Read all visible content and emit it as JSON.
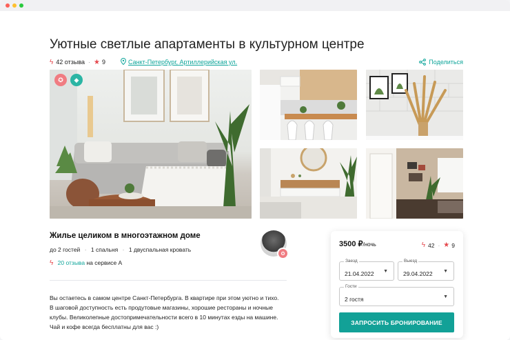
{
  "listing": {
    "title": "Уютные светлые апартаменты в культурном центре",
    "reviews_count": "42 отзыва",
    "rating": "9",
    "address": "Санкт-Петербург, Артиллерийская ул.",
    "share_label": "Поделиться"
  },
  "details": {
    "heading": "Жилье целиком в многоэтажном доме",
    "guests": "до 2 гостей",
    "bedrooms": "1 спальня",
    "beds": "1 двуспальная кровать",
    "service_reviews_link": "20 отзыва",
    "service_reviews_suffix": "на сервисе А",
    "description": "Вы остаетесь в самом центре Санкт-Петербурга. В квартире при этом уютно и тихо. В шаговой доступность есть продутовые магазины, хорошие рестораны и ночные клубы. Великолепные достопримечательности всего в 10 минутах езды на машине. Чай и кофе всегда бесплатны для вас :)"
  },
  "booking": {
    "price": "3500 ₽",
    "price_unit": "/ночь",
    "reviews": "42",
    "rating": "9",
    "checkin_label": "Заезд",
    "checkin_value": "21.04.2022",
    "checkout_label": "Выезд",
    "checkout_value": "29.04.2022",
    "guests_label": "Гости",
    "guests_value": "2 гостя",
    "button_label": "ЗАПРОСИТЬ БРОНИРОВАНИЕ"
  },
  "colors": {
    "accent": "#0ea59a",
    "badge": "#e5484d"
  },
  "icons": {
    "reviews": "bolt-icon",
    "rating": "star-icon",
    "location": "map-pin-icon",
    "share": "share-icon"
  }
}
